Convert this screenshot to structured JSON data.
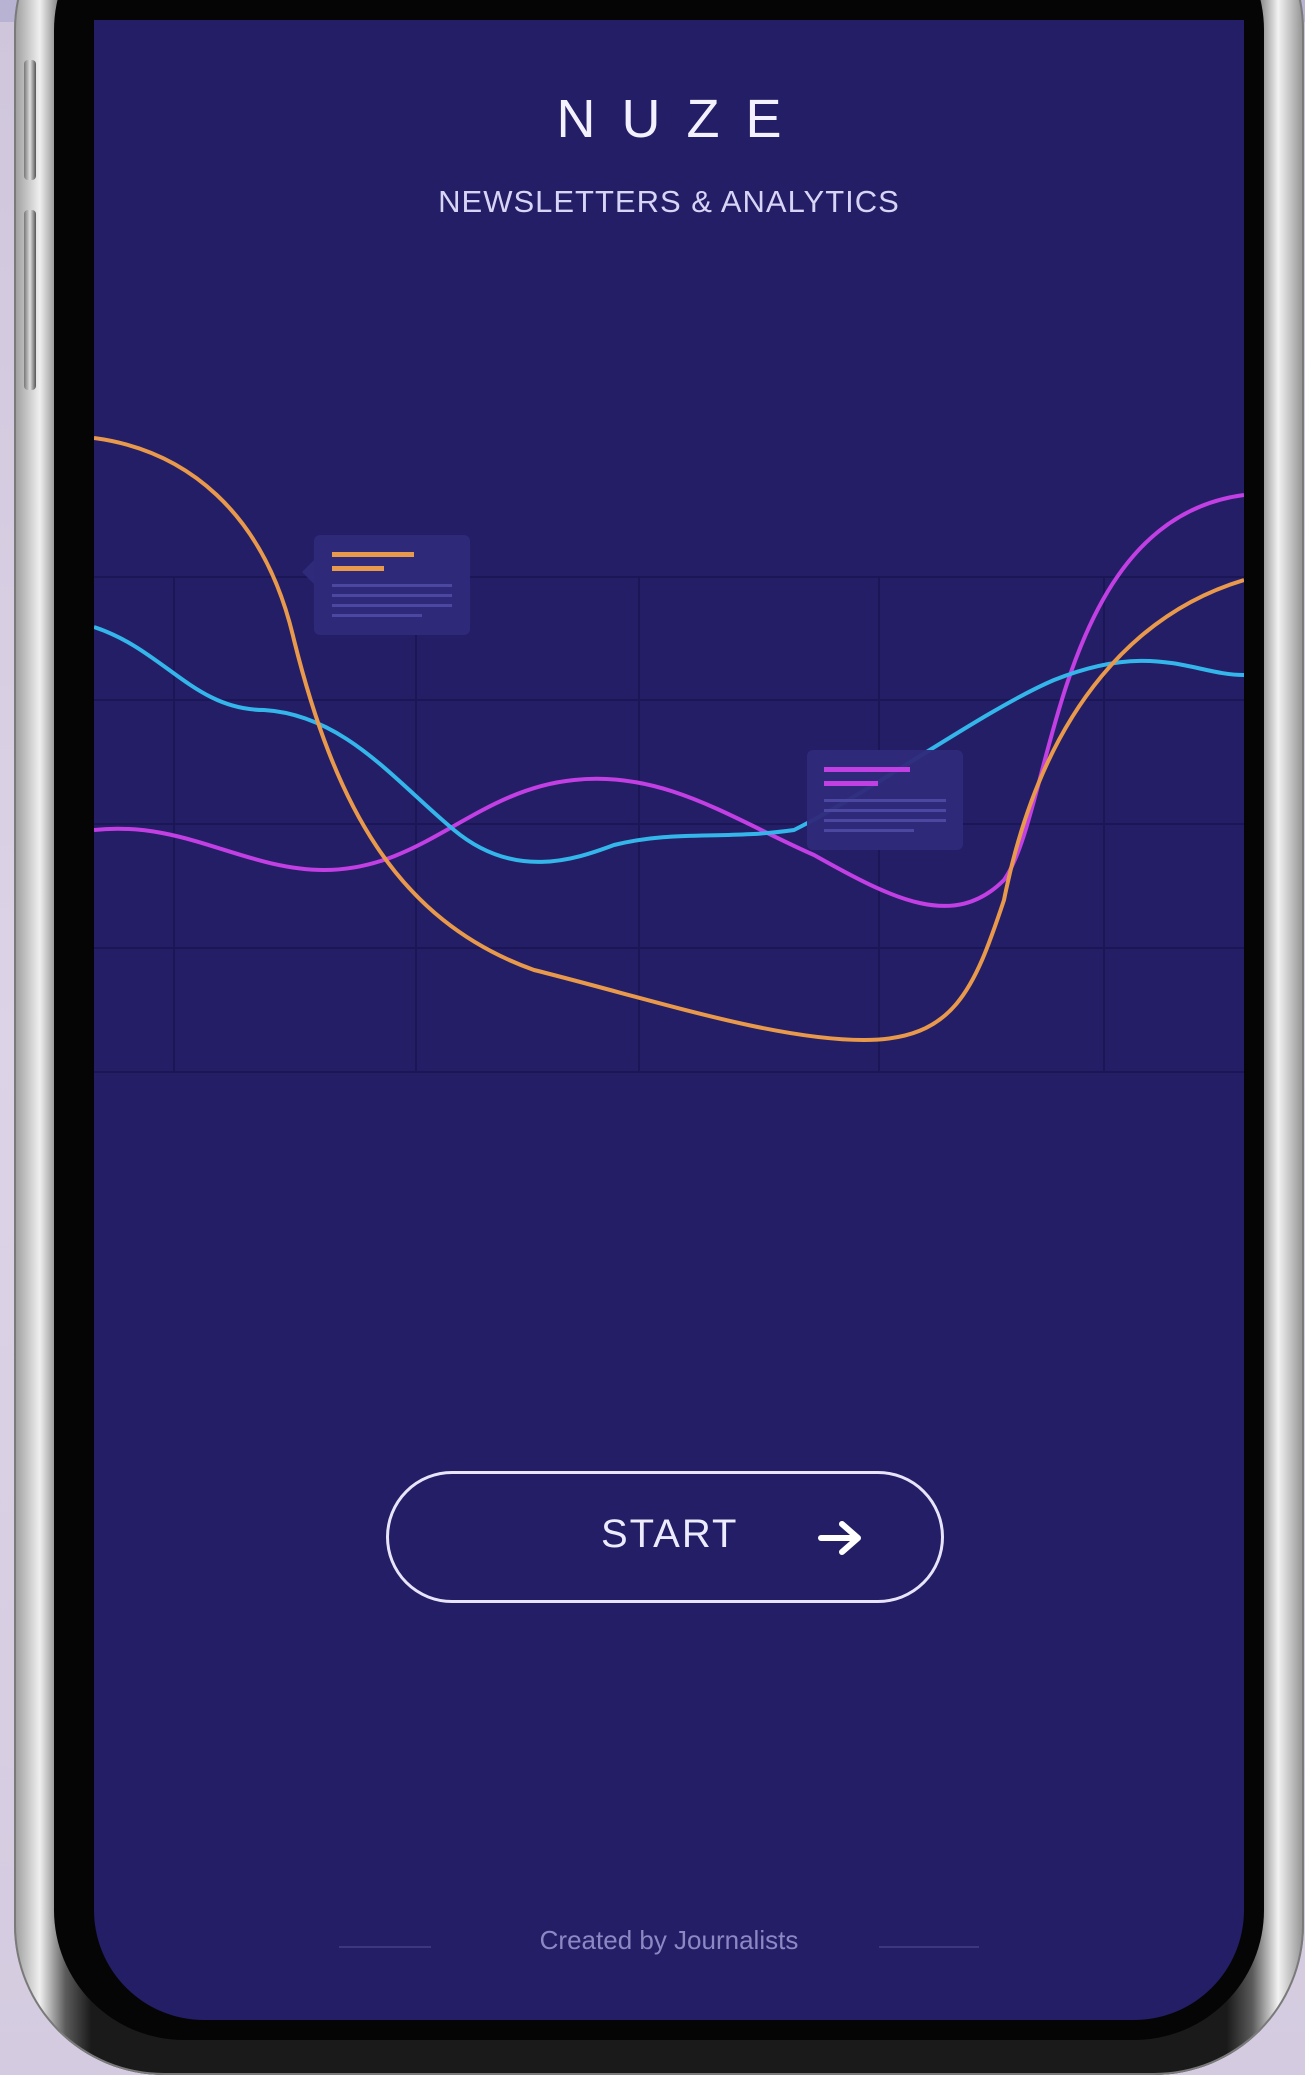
{
  "app": {
    "brand": "NUZE",
    "subtitle": "NEWSLETTERS & ANALYTICS"
  },
  "illustration": {
    "series": [
      {
        "color": "#e8994b"
      },
      {
        "color": "#34b6ea"
      },
      {
        "color": "#c23fe3"
      }
    ],
    "tooltips": [
      {
        "accent": "#e8994b"
      },
      {
        "accent": "#c23fe3"
      }
    ]
  },
  "start_button": {
    "label": "START",
    "icon": "arrow-right-icon"
  },
  "footer": {
    "text": "Created by Journalists"
  },
  "colors": {
    "screen_background": "#231e66",
    "grid": "#1c1856",
    "text": "#f3f1ff",
    "button_border": "#e7e4fb"
  }
}
